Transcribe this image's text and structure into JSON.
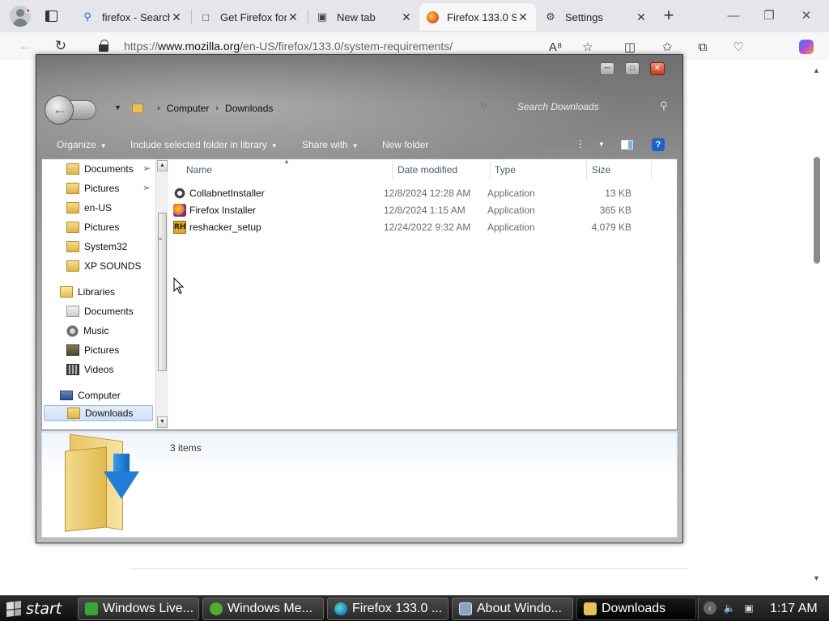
{
  "browser": {
    "tabs": [
      {
        "label": "firefox - Search",
        "icon": "search-icon"
      },
      {
        "label": "Get Firefox for",
        "icon": "page-icon"
      },
      {
        "label": "New tab",
        "icon": "newtab-icon"
      },
      {
        "label": "Firefox 133.0 S",
        "icon": "firefox-icon"
      },
      {
        "label": "Settings",
        "icon": "gear-icon"
      }
    ],
    "new_tab_symbol": "+",
    "url_prefix": "https://",
    "url_host": "www.mozilla.org",
    "url_path": "/en-US/firefox/133.0/system-requirements/"
  },
  "explorer": {
    "breadcrumb": [
      "Computer",
      "Downloads"
    ],
    "search_placeholder": "Search Downloads",
    "commands": {
      "organize": "Organize",
      "include": "Include selected folder in library",
      "share": "Share with",
      "new_folder": "New folder"
    },
    "help_label": "?",
    "nav_items": [
      {
        "label": "Documents",
        "icon": "folder",
        "pinned": true
      },
      {
        "label": "Pictures",
        "icon": "folder",
        "pinned": true
      },
      {
        "label": "en-US",
        "icon": "folder"
      },
      {
        "label": "Pictures",
        "icon": "folder"
      },
      {
        "label": "System32",
        "icon": "folder"
      },
      {
        "label": "XP SOUNDS",
        "icon": "folder"
      },
      {
        "label": "Libraries",
        "icon": "library"
      },
      {
        "label": "Documents",
        "icon": "documents-library"
      },
      {
        "label": "Music",
        "icon": "music-library"
      },
      {
        "label": "Pictures",
        "icon": "pictures-library"
      },
      {
        "label": "Videos",
        "icon": "videos-library"
      },
      {
        "label": "Computer",
        "icon": "computer"
      },
      {
        "label": "Downloads",
        "icon": "downloads-folder",
        "selected": true
      }
    ],
    "columns": {
      "name": "Name",
      "date": "Date modified",
      "type": "Type",
      "size": "Size"
    },
    "files": [
      {
        "name": "CollabnetInstaller",
        "date": "12/8/2024 12:28 AM",
        "type": "Application",
        "size": "13 KB",
        "icon": "installer-icon"
      },
      {
        "name": "Firefox Installer",
        "date": "12/8/2024 1:15 AM",
        "type": "Application",
        "size": "365 KB",
        "icon": "firefox-icon"
      },
      {
        "name": "reshacker_setup",
        "date": "12/24/2022 9:32 AM",
        "type": "Application",
        "size": "4,079 KB",
        "icon": "reshacker-icon"
      }
    ],
    "item_count": "3 items"
  },
  "taskbar": {
    "start_label": "start",
    "buttons": [
      {
        "label": "Windows Live...",
        "icon_color": "#3aa63a"
      },
      {
        "label": "Windows Me...",
        "icon_color": "#4cae2e"
      },
      {
        "label": "Firefox 133.0 ...",
        "icon_color": "#1e8be0"
      },
      {
        "label": "About Windo...",
        "icon_color": "#8aa2c7"
      },
      {
        "label": "Downloads",
        "icon_color": "#e7c25a",
        "active": true
      }
    ],
    "clock": "1:17 AM"
  }
}
